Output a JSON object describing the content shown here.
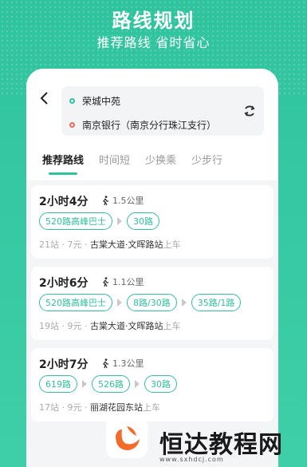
{
  "hero": {
    "title": "路线规划",
    "subtitle": "推荐路线 省时省心"
  },
  "route": {
    "origin": "荣城中苑",
    "destination": "南京银行（南京分行珠江支行）",
    "colors": {
      "origin": "#2ec39e",
      "destination": "#f36b5a"
    }
  },
  "tabs": [
    {
      "label": "推荐路线",
      "active": true
    },
    {
      "label": "时间短",
      "active": false
    },
    {
      "label": "少换乘",
      "active": false
    },
    {
      "label": "少步行",
      "active": false
    }
  ],
  "results": [
    {
      "time": "2小时4分",
      "walk": "1.5公里",
      "lines": [
        "520路高峰巴士",
        "30路"
      ],
      "stops": "21站",
      "price": "7元",
      "station": "古棠大道·文晖路站",
      "board": "上车"
    },
    {
      "time": "2小时6分",
      "walk": "1.1公里",
      "lines": [
        "520路高峰巴士",
        "8路/30路",
        "35路/1路"
      ],
      "stops": "19站",
      "price": "9元",
      "station": "古棠大道·文晖路站",
      "board": "上车"
    },
    {
      "time": "2小时7分",
      "walk": "1.3公里",
      "lines": [
        "619路",
        "526路",
        "30路"
      ],
      "stops": "17站",
      "price": "9元",
      "station": "丽湖花园东站",
      "board": "上车"
    }
  ],
  "watermark": {
    "brand": "恒达教程网",
    "url": "www.sxhdcj.com"
  },
  "accent": "#2ec39e"
}
